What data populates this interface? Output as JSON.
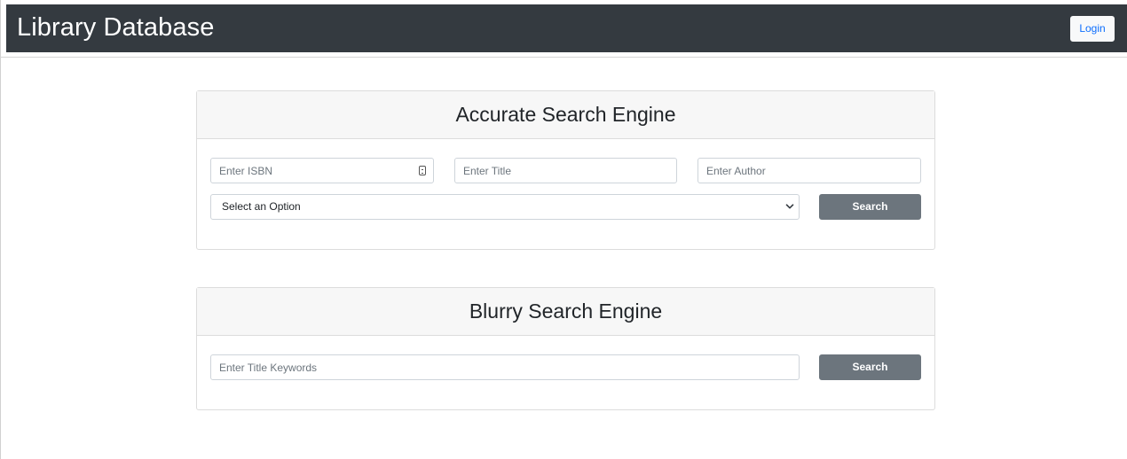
{
  "app": {
    "brand": "Library Database",
    "login_label": "Login"
  },
  "accurate": {
    "title": "Accurate Search Engine",
    "isbn_placeholder": "Enter ISBN",
    "title_placeholder": "Enter Title",
    "author_placeholder": "Enter Author",
    "select_value": "Select an Option",
    "search_label": "Search"
  },
  "blurry": {
    "title": "Blurry Search Engine",
    "keywords_placeholder": "Enter Title Keywords",
    "search_label": "Search"
  },
  "icons": {
    "isbn_field_icon": "autofill-contact-icon",
    "select_icon": "chevron-down-icon"
  },
  "colors": {
    "navbar": "#343a40",
    "login_text": "#0d6efd",
    "search_button": "#6c757d",
    "card_header": "#f7f7f7"
  }
}
